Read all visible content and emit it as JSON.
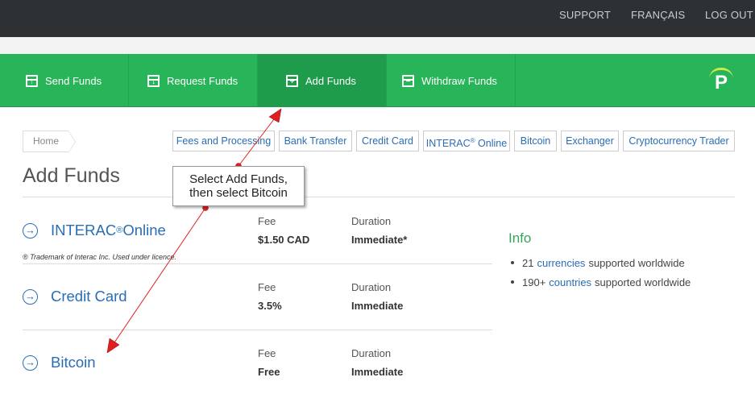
{
  "topnav": {
    "support": "SUPPORT",
    "francais": "FRANÇAIS",
    "logout": "LOG OUT"
  },
  "tabs": [
    {
      "label": "Send Funds",
      "icon": "send-funds-icon"
    },
    {
      "label": "Request Funds",
      "icon": "request-funds-icon"
    },
    {
      "label": "Add Funds",
      "icon": "add-funds-icon",
      "active": true
    },
    {
      "label": "Withdraw Funds",
      "icon": "withdraw-funds-icon"
    }
  ],
  "logo": "P",
  "breadcrumb": {
    "home": "Home"
  },
  "pills": [
    {
      "label": "Fees and Processing"
    },
    {
      "label": "Bank Transfer"
    },
    {
      "label": "Credit Card"
    },
    {
      "label": "INTERAC",
      "sup": "®",
      "suffix": " Online"
    },
    {
      "label": "Bitcoin"
    },
    {
      "label": "Exchanger"
    },
    {
      "label": "Cryptocurrency Trader"
    }
  ],
  "page_title": "Add Funds",
  "methods": [
    {
      "name": "INTERAC",
      "sup": "®",
      "suffix": " Online",
      "fee_label": "Fee",
      "fee": "$1.50 CAD",
      "duration_label": "Duration",
      "duration": "Immediate*",
      "note": "® Trademark of Interac Inc. Used under licence."
    },
    {
      "name": "Credit Card",
      "fee_label": "Fee",
      "fee": "3.5%",
      "duration_label": "Duration",
      "duration": "Immediate"
    },
    {
      "name": "Bitcoin",
      "fee_label": "Fee",
      "fee": "Free",
      "duration_label": "Duration",
      "duration": "Immediate"
    }
  ],
  "info": {
    "title": "Info",
    "items": [
      {
        "pre": "21",
        "link": "currencies",
        "post": "supported worldwide"
      },
      {
        "pre": "190+",
        "link": "countries",
        "post": "supported worldwide"
      }
    ]
  },
  "callout": {
    "line1": "Select Add Funds,",
    "line2": "then select Bitcoin"
  },
  "colors": {
    "topbar": "#2e3133",
    "green": "#28b458",
    "green_active": "#1f9c4b",
    "link": "#2a6db5",
    "info_title": "#3aa35a",
    "annotation": "#e02020"
  }
}
